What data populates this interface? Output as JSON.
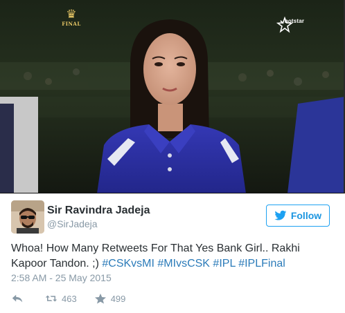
{
  "media": {
    "broadcast_badge": {
      "word": "FINAL",
      "icon": "trophy-icon"
    },
    "channel_logo": {
      "word": "hotstar",
      "icon": "star-icon"
    }
  },
  "tweet": {
    "author": {
      "name": "Sir Ravindra Jadeja",
      "handle": "@SirJadeja"
    },
    "follow_label": "Follow",
    "text_plain": "Whoa! How Many Retweets For That Yes Bank Girl.. Rakhi Kapoor Tandon.  ;) ",
    "hashtags": [
      "#CSKvsMI",
      "#MIvsCSK",
      "#IPL",
      "#IPLFinal"
    ],
    "timestamp": "2:58 AM - 25 May 2015",
    "actions": {
      "reply_icon": "reply-icon",
      "retweet_icon": "retweet-icon",
      "retweet_count": "463",
      "like_icon": "star-icon",
      "like_count": "499"
    }
  },
  "colors": {
    "link": "#2b7bb9",
    "follow_border": "#1da1f2",
    "muted": "#8899a6",
    "text": "#292f33",
    "shirt_blue": "#2a2fa0"
  }
}
